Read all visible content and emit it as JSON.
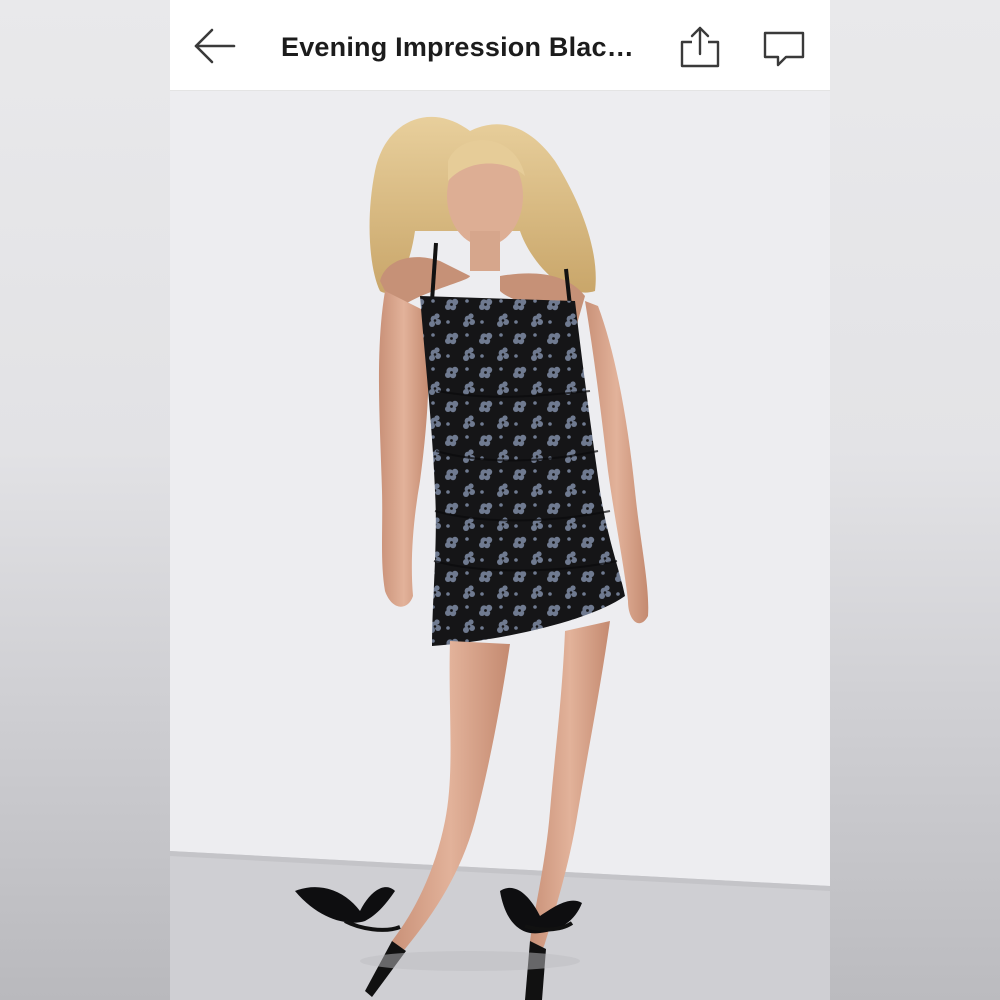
{
  "nav": {
    "title": "Evening Impression Blac…",
    "back_icon": "arrow-left-icon",
    "share_icon": "share-upload-icon",
    "chat_icon": "chat-bubble-icon"
  },
  "product_image": {
    "background_color": "#ededf0",
    "floor_color": "#cfcfd3",
    "dress_color": "#151517",
    "flower_color": "#6f7a90"
  }
}
